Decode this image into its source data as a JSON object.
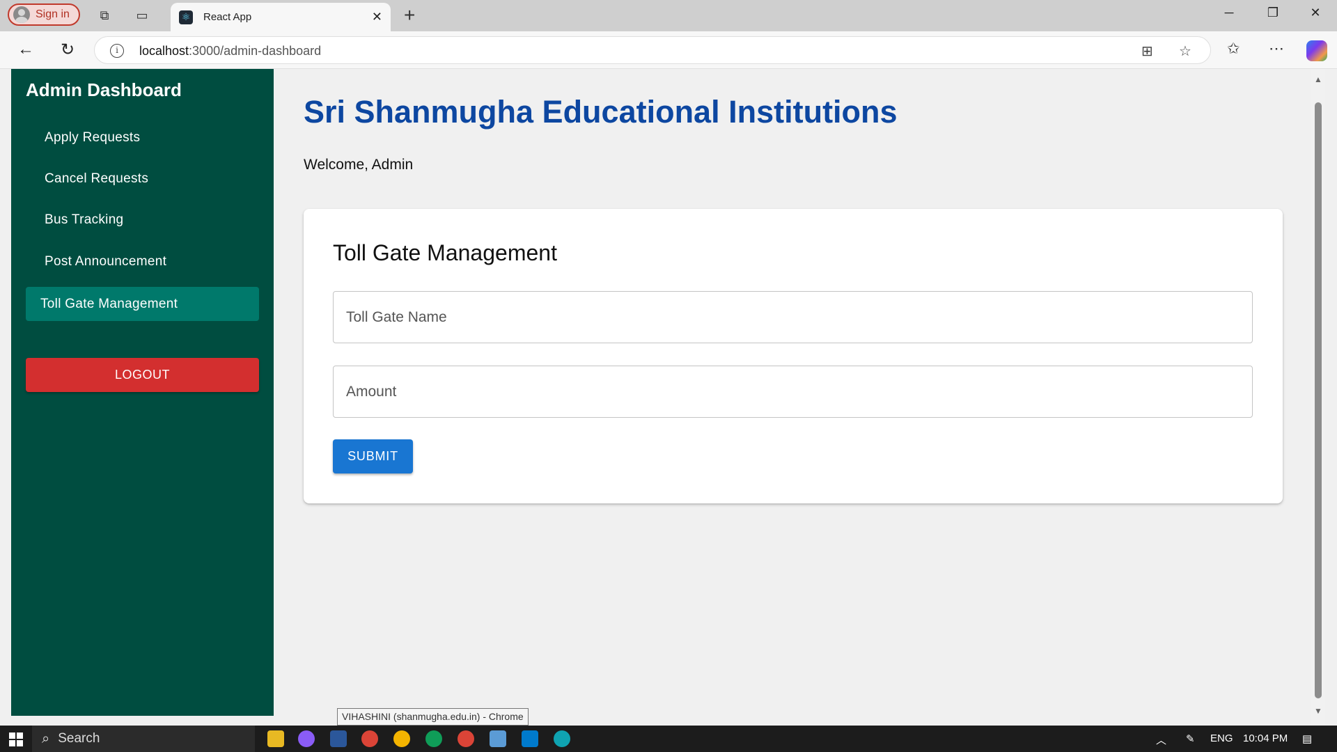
{
  "browser": {
    "signin_label": "Sign in",
    "tab_title": "React App",
    "url_host": "localhost",
    "url_path": ":3000/admin-dashboard"
  },
  "sidebar": {
    "title": "Admin Dashboard",
    "items": [
      {
        "label": "Apply Requests",
        "active": false
      },
      {
        "label": "Cancel Requests",
        "active": false
      },
      {
        "label": "Bus Tracking",
        "active": false
      },
      {
        "label": "Post Announcement",
        "active": false
      },
      {
        "label": "Toll Gate Management",
        "active": true
      }
    ],
    "logout_label": "LOGOUT"
  },
  "main": {
    "title": "Sri Shanmugha Educational Institutions",
    "welcome": "Welcome, Admin",
    "card": {
      "title": "Toll Gate Management",
      "fields": {
        "toll_gate_name_placeholder": "Toll Gate Name",
        "amount_placeholder": "Amount"
      },
      "submit_label": "SUBMIT"
    }
  },
  "tooltip": "VIHASHINI (shanmugha.edu.in) - Chrome",
  "taskbar": {
    "search_label": "Search",
    "language": "ENG",
    "time": "10:04 PM"
  },
  "colors": {
    "sidebar_bg": "#004d40",
    "sidebar_active": "#00796b",
    "logout_bg": "#d32f2f",
    "title_blue": "#0d47a1",
    "submit_bg": "#1976d2"
  }
}
